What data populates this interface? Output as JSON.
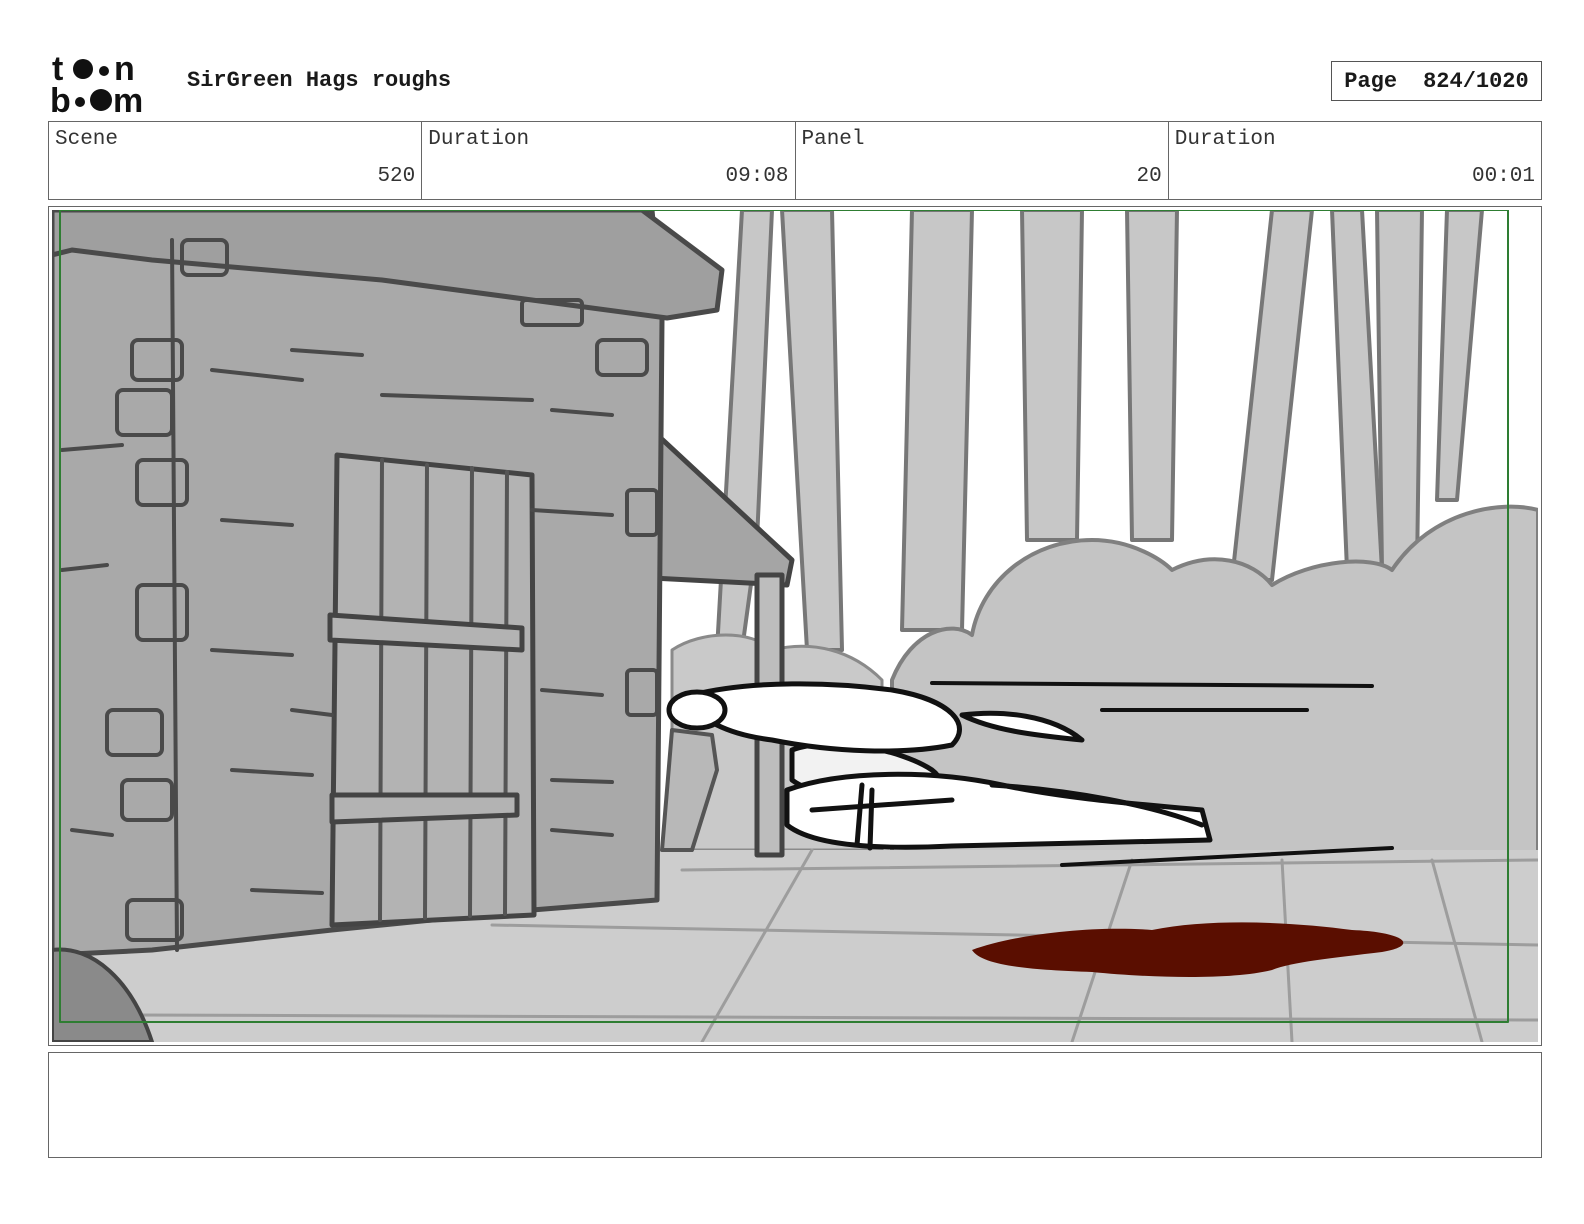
{
  "header": {
    "logo_text": "toon boom",
    "title": "SirGreen Hags roughs",
    "page_label": "Page",
    "page_value": "824/1020"
  },
  "info": [
    {
      "label": "Scene",
      "value": "520"
    },
    {
      "label": "Duration",
      "value": "09:08"
    },
    {
      "label": "Panel",
      "value": "20"
    },
    {
      "label": "Duration",
      "value": "00:01"
    }
  ],
  "panel": {
    "description": "",
    "colors": {
      "safe_frame": "#2e7d32",
      "blood": "#5a0e00",
      "wall": "#a9a9a9",
      "ground": "#cfcfcf",
      "forest": "#c4c4c4"
    }
  },
  "notes": {
    "text": ""
  }
}
